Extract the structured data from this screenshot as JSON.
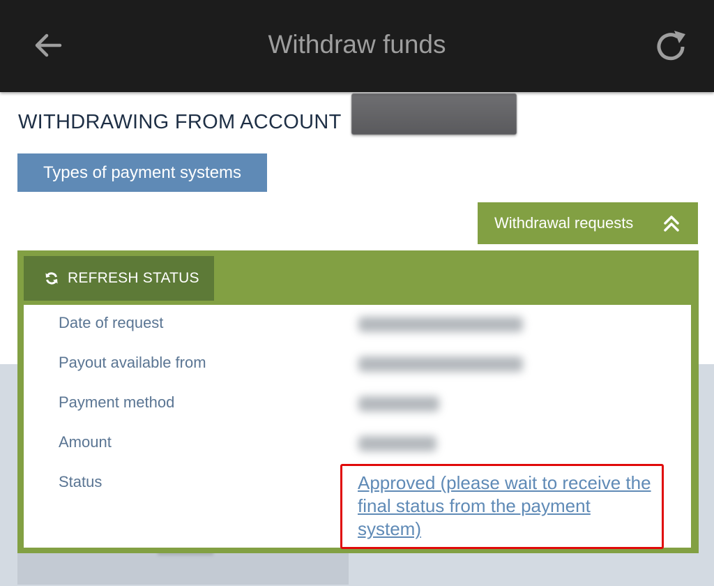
{
  "appbar": {
    "title": "Withdraw funds",
    "back_icon": "arrow-left-icon",
    "refresh_icon": "refresh-icon"
  },
  "account": {
    "heading": "WITHDRAWING FROM ACCOUNT"
  },
  "buttons": {
    "types_label": "Types of payment systems",
    "withdrawal_requests_label": "Withdrawal requests",
    "withdrawal_requests_icon": "chevron-double-up-icon",
    "refresh_status_label": "REFRESH STATUS",
    "refresh_status_icon": "sync-icon"
  },
  "request": {
    "rows": [
      {
        "label": "Date of request"
      },
      {
        "label": "Payout available from"
      },
      {
        "label": "Payment method"
      },
      {
        "label": "Amount"
      },
      {
        "label": "Status"
      }
    ],
    "status_text": "Approved (please wait to receive the final status from the payment system)"
  },
  "colors": {
    "appbar_bg": "#1c1c1c",
    "primary_blue": "#5f8ab6",
    "accent_green": "#82a043",
    "dark_green": "#5d7a37",
    "highlight_red": "#e00a0a"
  }
}
